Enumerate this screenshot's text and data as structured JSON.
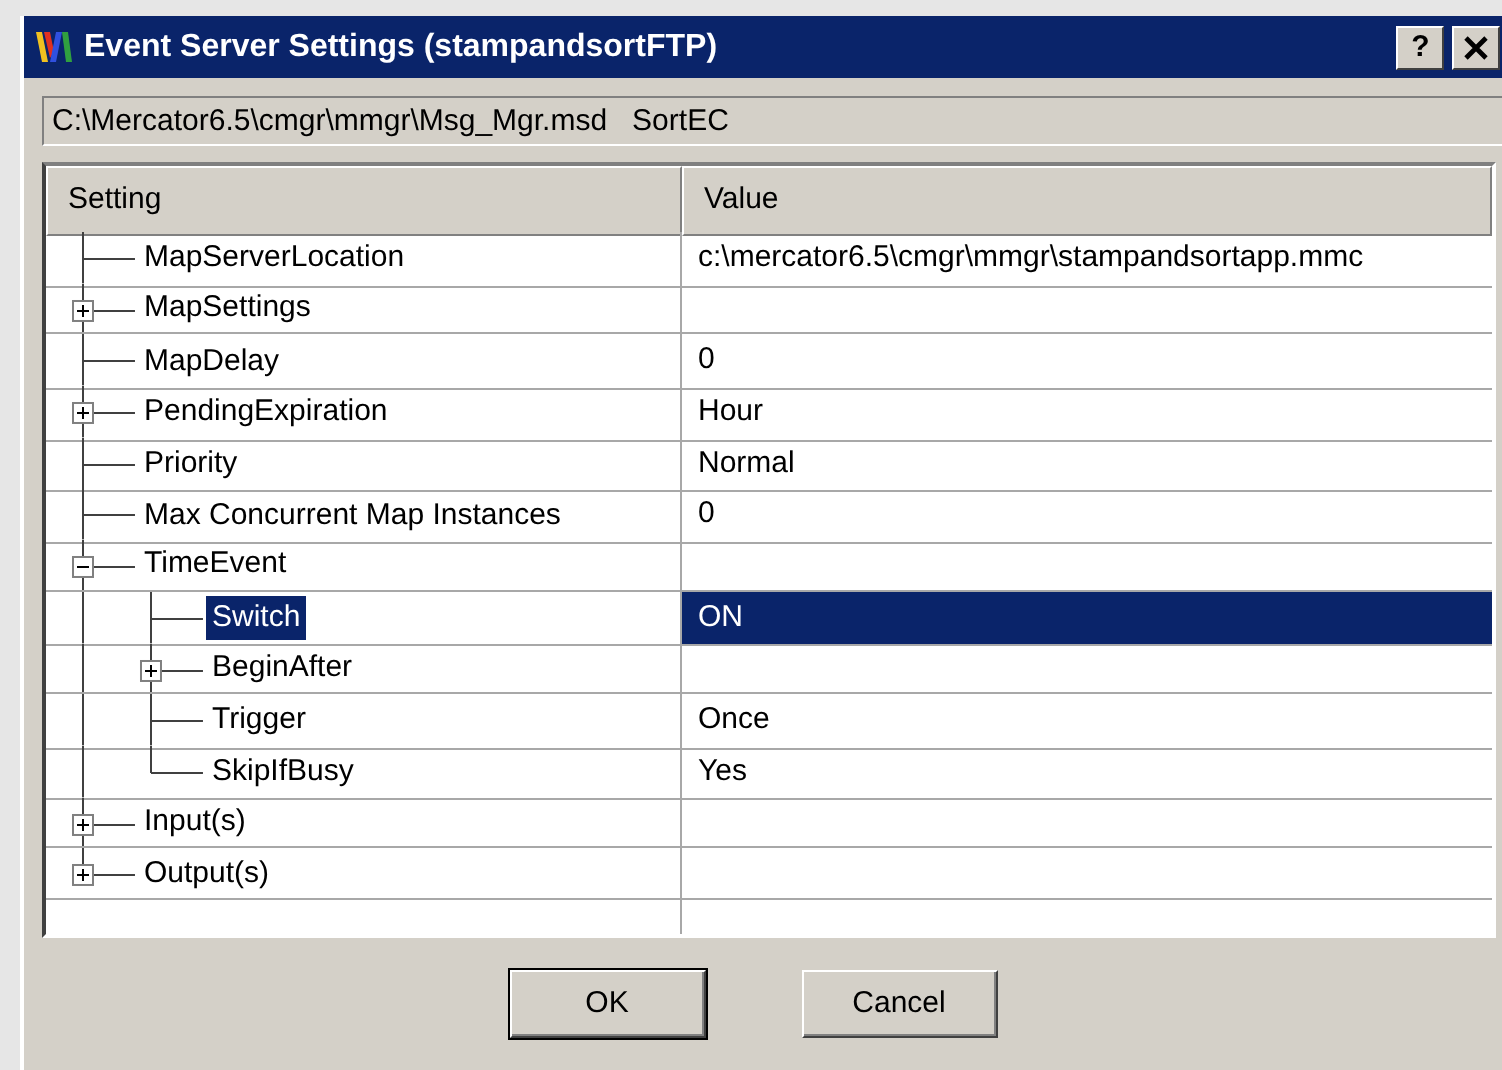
{
  "window": {
    "title": "Event Server Settings (stampandsortFTP)",
    "help_button": "?"
  },
  "path": "C:\\Mercator6.5\\cmgr\\mmgr\\Msg_Mgr.msd   SortEC",
  "table": {
    "columns": [
      "Setting",
      "Value"
    ],
    "rows": [
      {
        "setting": "MapServerLocation",
        "value": "c:\\mercator6.5\\cmgr\\mmgr\\stampandsortapp.mmc",
        "selected": false
      },
      {
        "setting": "MapSettings",
        "expanded": false,
        "selected": false
      },
      {
        "setting": "MapDelay",
        "value": "0",
        "selected": false
      },
      {
        "setting": "PendingExpiration",
        "value": "Hour",
        "expanded": false,
        "selected": false
      },
      {
        "setting": "Priority",
        "value": "Normal",
        "selected": false
      },
      {
        "setting": "Max Concurrent Map Instances",
        "value": "0",
        "selected": false
      },
      {
        "setting": "TimeEvent",
        "expanded": true,
        "selected": false,
        "children": [
          {
            "setting": "Switch",
            "value": "ON",
            "selected": true
          },
          {
            "setting": "BeginAfter",
            "expanded": false,
            "selected": false
          },
          {
            "setting": "Trigger",
            "value": "Once",
            "selected": false
          },
          {
            "setting": "SkipIfBusy",
            "value": "Yes",
            "selected": false
          }
        ]
      },
      {
        "setting": "Input(s)",
        "expanded": false,
        "selected": false
      },
      {
        "setting": "Output(s)",
        "expanded": false,
        "selected": false
      }
    ]
  },
  "buttons": [
    "OK",
    "Cancel"
  ]
}
